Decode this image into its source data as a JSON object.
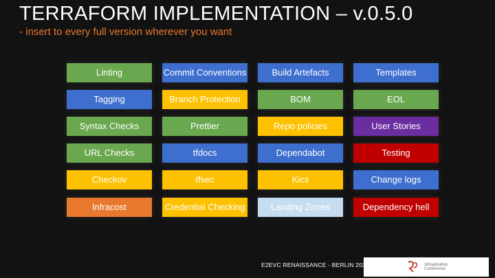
{
  "slide": {
    "title": "TERRAFORM IMPLEMENTATION – v.0.5.0",
    "subtitle": "- insert to every full version wherever you want"
  },
  "colors": {
    "background": "#121212",
    "green": "#6aa84f",
    "blue": "#3e6fcf",
    "yellow": "#fdc100",
    "orange": "#e8792e",
    "purple": "#6a2ea0",
    "red": "#c00000",
    "lightblue": "#c6dcf0",
    "subtitle": "#e8782c"
  },
  "tiles": [
    {
      "label": "Linting",
      "color": "green"
    },
    {
      "label": "Commit Conventions",
      "color": "blue"
    },
    {
      "label": "Build Artefacts",
      "color": "blue"
    },
    {
      "label": "Templates",
      "color": "blue"
    },
    {
      "label": "Tagging",
      "color": "blue"
    },
    {
      "label": "Branch Protection",
      "color": "yellow"
    },
    {
      "label": "BOM",
      "color": "green"
    },
    {
      "label": "EOL",
      "color": "green"
    },
    {
      "label": "Syntax Checks",
      "color": "green"
    },
    {
      "label": "Prettier",
      "color": "green"
    },
    {
      "label": "Repo policies",
      "color": "yellow"
    },
    {
      "label": "User Stories",
      "color": "purple"
    },
    {
      "label": "URL Checks",
      "color": "green"
    },
    {
      "label": "tfdocs",
      "color": "blue"
    },
    {
      "label": "Dependabot",
      "color": "blue"
    },
    {
      "label": "Testing",
      "color": "red"
    },
    {
      "label": "Checkov",
      "color": "yellow"
    },
    {
      "label": "tfsec",
      "color": "yellow"
    },
    {
      "label": "Kics",
      "color": "yellow"
    },
    {
      "label": "Change logs",
      "color": "blue"
    },
    {
      "label": "Infracost",
      "color": "orange"
    },
    {
      "label": "Credential Checking",
      "color": "yellow"
    },
    {
      "label": "Landing Zones",
      "color": "lightblue"
    },
    {
      "label": "Dependency hell",
      "color": "red"
    }
  ],
  "footer": {
    "event": "E2EVC RENAISSANCE - BERLIN 2022",
    "logo_line1": "Virtualization",
    "logo_line2": "Conference"
  }
}
